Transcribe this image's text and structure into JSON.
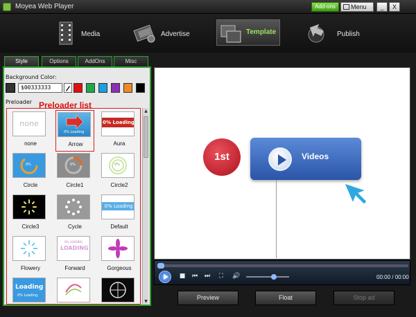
{
  "window": {
    "title": "Moyea Web Player",
    "addons_label": "Add-ons",
    "menu_label": "Menu",
    "minimize_label": "_",
    "close_label": "X"
  },
  "toolbar": {
    "items": [
      {
        "label": "Media",
        "icon": "film-strip-icon"
      },
      {
        "label": "Advertise",
        "icon": "advertise-icon"
      },
      {
        "label": "Template",
        "icon": "template-icon",
        "active": true
      },
      {
        "label": "Publish",
        "icon": "publish-icon"
      }
    ],
    "active_color": "#9be05f"
  },
  "panel": {
    "tabs": [
      "Style",
      "Options",
      "AddOns",
      "Misc"
    ],
    "background_color_label": "Background Color:",
    "hex_value": "$00333333",
    "swatches": [
      "#333333",
      "#e01010",
      "#1ea84a",
      "#1a9fe0",
      "#8b2fb8",
      "#ee8a2a",
      "#000000"
    ],
    "preloader_label": "Preloader",
    "annotation": "Preloader list",
    "preloaders": [
      {
        "label": "none",
        "selected": false
      },
      {
        "label": "Arrow",
        "selected": true
      },
      {
        "label": "Aura",
        "selected": false
      },
      {
        "label": "Circle",
        "selected": false
      },
      {
        "label": "Circle1",
        "selected": false
      },
      {
        "label": "Circle2",
        "selected": false
      },
      {
        "label": "Circle3",
        "selected": false
      },
      {
        "label": "Cycle",
        "selected": false
      },
      {
        "label": "Default",
        "selected": false
      },
      {
        "label": "Flowery",
        "selected": false
      },
      {
        "label": "Forward",
        "selected": false
      },
      {
        "label": "Gorgeous",
        "selected": false
      },
      {
        "label": "",
        "selected": false
      },
      {
        "label": "",
        "selected": false
      },
      {
        "label": "",
        "selected": false
      }
    ],
    "thumb_texts": {
      "none": "none",
      "arrow_caption": "0% Loading",
      "aura": "0% Loading",
      "circle": "0%",
      "circle1": "0%",
      "circle2": "0%",
      "default": "0% Loading",
      "forward": "LOADING",
      "forward_sub": "0% LOADING",
      "loading": "Loading",
      "loading_sub": "0% Loading"
    }
  },
  "preview": {
    "badge_text": "1st",
    "videos_label": "Videos"
  },
  "player": {
    "time": "00:00 / 00:00",
    "volume": 0.65,
    "progress": 0.0
  },
  "bottom": {
    "preview_label": "Preview",
    "float_label": "Float",
    "stop_label": "Stop ad"
  }
}
